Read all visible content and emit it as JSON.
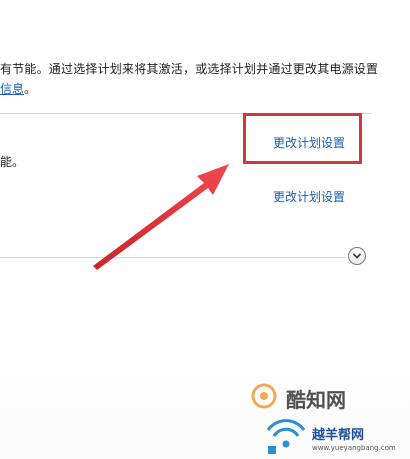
{
  "intro": {
    "line1": "有节能。通过选择计划来将其激活，或选择计划并通过更改其电源设置",
    "link": "信息",
    "line2_suffix": "。"
  },
  "plans": {
    "description": "能。",
    "links": [
      "更改计划设置",
      "更改计划设置"
    ]
  },
  "watermark": {
    "main": "酷知网",
    "sub": "越羊帮网",
    "url": "www.yueyangbang.com"
  },
  "colors": {
    "link": "#1a5fb4",
    "highlight": "#d9343a",
    "arrow": "#e0323a"
  }
}
